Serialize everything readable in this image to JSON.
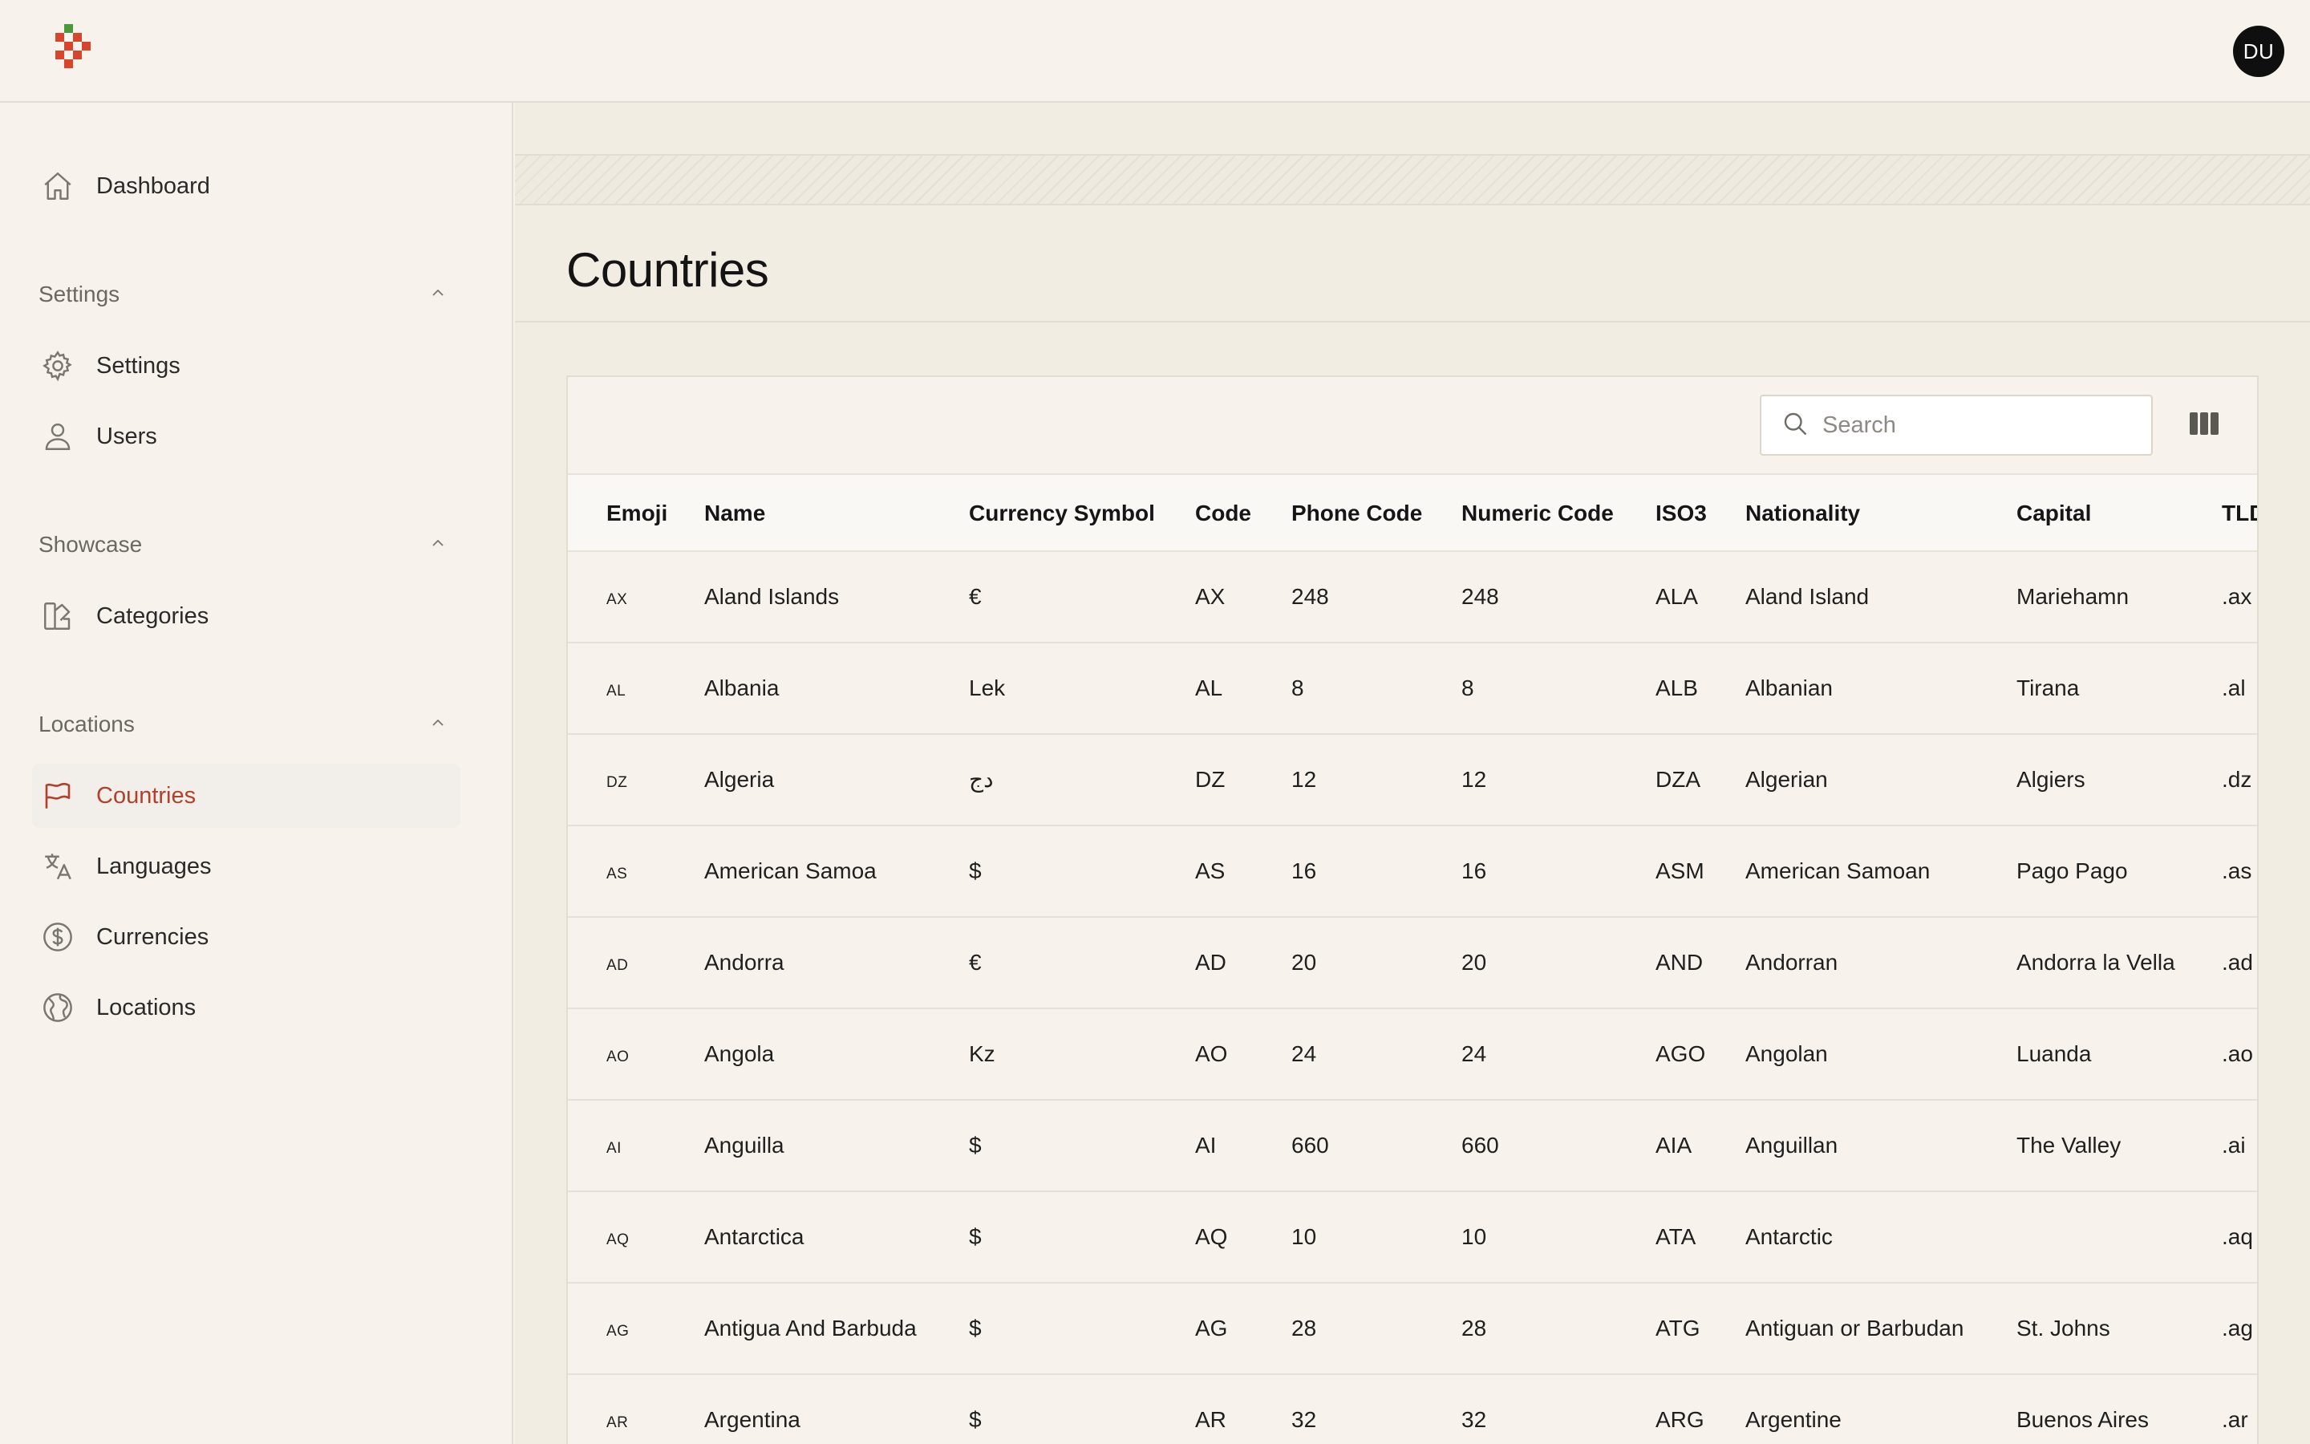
{
  "header": {
    "avatar_initials": "DU"
  },
  "sidebar": {
    "dashboard": "Dashboard",
    "sections": [
      {
        "label": "Settings",
        "items": [
          {
            "label": "Settings",
            "icon": "gear-icon"
          },
          {
            "label": "Users",
            "icon": "user-icon"
          }
        ]
      },
      {
        "label": "Showcase",
        "items": [
          {
            "label": "Categories",
            "icon": "swatch-icon"
          }
        ]
      },
      {
        "label": "Locations",
        "items": [
          {
            "label": "Countries",
            "icon": "flag-icon",
            "active": true
          },
          {
            "label": "Languages",
            "icon": "translate-icon"
          },
          {
            "label": "Currencies",
            "icon": "dollar-circle-icon"
          },
          {
            "label": "Locations",
            "icon": "globe-icon"
          }
        ]
      }
    ]
  },
  "main": {
    "title": "Countries",
    "search": {
      "placeholder": "Search",
      "value": ""
    },
    "columns": [
      "Emoji",
      "Name",
      "Currency Symbol",
      "Code",
      "Phone Code",
      "Numeric Code",
      "ISO3",
      "Nationality",
      "Capital",
      "TLD"
    ],
    "rows": [
      [
        "AX",
        "Aland Islands",
        "€",
        "AX",
        "248",
        "248",
        "ALA",
        "Aland Island",
        "Mariehamn",
        ".ax"
      ],
      [
        "AL",
        "Albania",
        "Lek",
        "AL",
        "8",
        "8",
        "ALB",
        "Albanian",
        "Tirana",
        ".al"
      ],
      [
        "DZ",
        "Algeria",
        "دج",
        "DZ",
        "12",
        "12",
        "DZA",
        "Algerian",
        "Algiers",
        ".dz"
      ],
      [
        "AS",
        "American Samoa",
        "$",
        "AS",
        "16",
        "16",
        "ASM",
        "American Samoan",
        "Pago Pago",
        ".as"
      ],
      [
        "AD",
        "Andorra",
        "€",
        "AD",
        "20",
        "20",
        "AND",
        "Andorran",
        "Andorra la Vella",
        ".ad"
      ],
      [
        "AO",
        "Angola",
        "Kz",
        "AO",
        "24",
        "24",
        "AGO",
        "Angolan",
        "Luanda",
        ".ao"
      ],
      [
        "AI",
        "Anguilla",
        "$",
        "AI",
        "660",
        "660",
        "AIA",
        "Anguillan",
        "The Valley",
        ".ai"
      ],
      [
        "AQ",
        "Antarctica",
        "$",
        "AQ",
        "10",
        "10",
        "ATA",
        "Antarctic",
        "",
        ".aq"
      ],
      [
        "AG",
        "Antigua And Barbuda",
        "$",
        "AG",
        "28",
        "28",
        "ATG",
        "Antiguan or Barbudan",
        "St. Johns",
        ".ag"
      ],
      [
        "AR",
        "Argentina",
        "$",
        "AR",
        "32",
        "32",
        "ARG",
        "Argentine",
        "Buenos Aires",
        ".ar"
      ]
    ]
  },
  "colors": {
    "accent": "#b2402a",
    "background": "#f7f3ec",
    "main_background": "#f1ede3"
  }
}
